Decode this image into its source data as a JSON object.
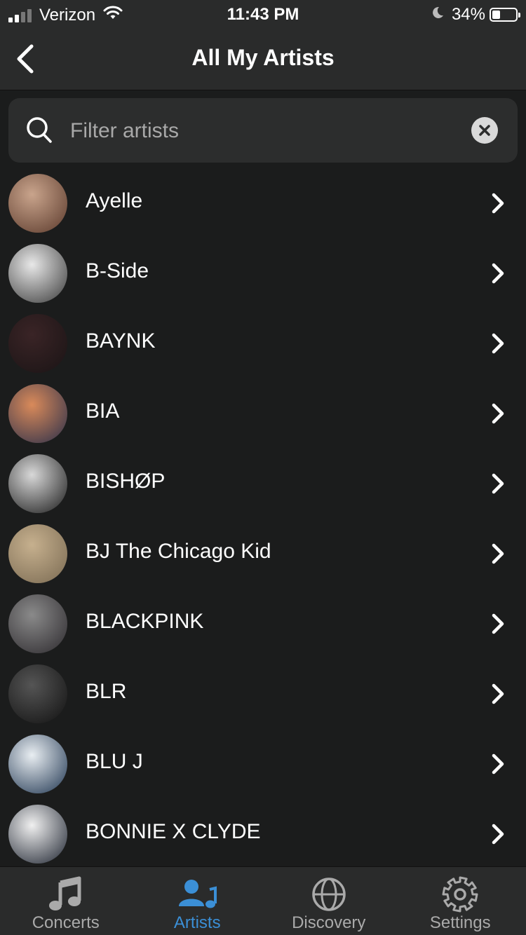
{
  "status_bar": {
    "carrier": "Verizon",
    "time": "11:43 PM",
    "battery_percent": "34%",
    "battery_level": 0.34,
    "signal_bars_filled": 2,
    "signal_bars_total": 4
  },
  "nav": {
    "title": "All My Artists",
    "back_icon": "chevron-left-icon"
  },
  "search": {
    "placeholder": "Filter artists",
    "value": ""
  },
  "artists": [
    {
      "name": "Ayelle",
      "avatar_colors": [
        "#c9a48c",
        "#5b3a2c"
      ]
    },
    {
      "name": "B-Side",
      "avatar_colors": [
        "#e8e8e8",
        "#3a3a3a"
      ]
    },
    {
      "name": "BAYNK",
      "avatar_colors": [
        "#3a2426",
        "#1a1415"
      ]
    },
    {
      "name": "BIA",
      "avatar_colors": [
        "#d98a5a",
        "#2b2f4a"
      ]
    },
    {
      "name": "BISHØP",
      "avatar_colors": [
        "#d8d8d8",
        "#1a1a1a"
      ]
    },
    {
      "name": "BJ The Chicago Kid",
      "avatar_colors": [
        "#c6b08e",
        "#7a6a52"
      ]
    },
    {
      "name": "BLACKPINK",
      "avatar_colors": [
        "#8a8a8a",
        "#2d2a2e"
      ]
    },
    {
      "name": "BLR",
      "avatar_colors": [
        "#555555",
        "#111111"
      ]
    },
    {
      "name": "BLU J",
      "avatar_colors": [
        "#e9eef2",
        "#1f3550"
      ]
    },
    {
      "name": "BONNIE X CLYDE",
      "avatar_colors": [
        "#f0f0f0",
        "#1e2430"
      ]
    }
  ],
  "tabs": [
    {
      "label": "Concerts",
      "icon": "music-note-icon",
      "active": false
    },
    {
      "label": "Artists",
      "icon": "artists-icon",
      "active": true
    },
    {
      "label": "Discovery",
      "icon": "globe-icon",
      "active": false
    },
    {
      "label": "Settings",
      "icon": "gear-icon",
      "active": false
    }
  ],
  "colors": {
    "background": "#1b1c1c",
    "bar": "#2a2b2b",
    "accent": "#3b8fd6",
    "inactive_tab": "#aaaaaa"
  }
}
